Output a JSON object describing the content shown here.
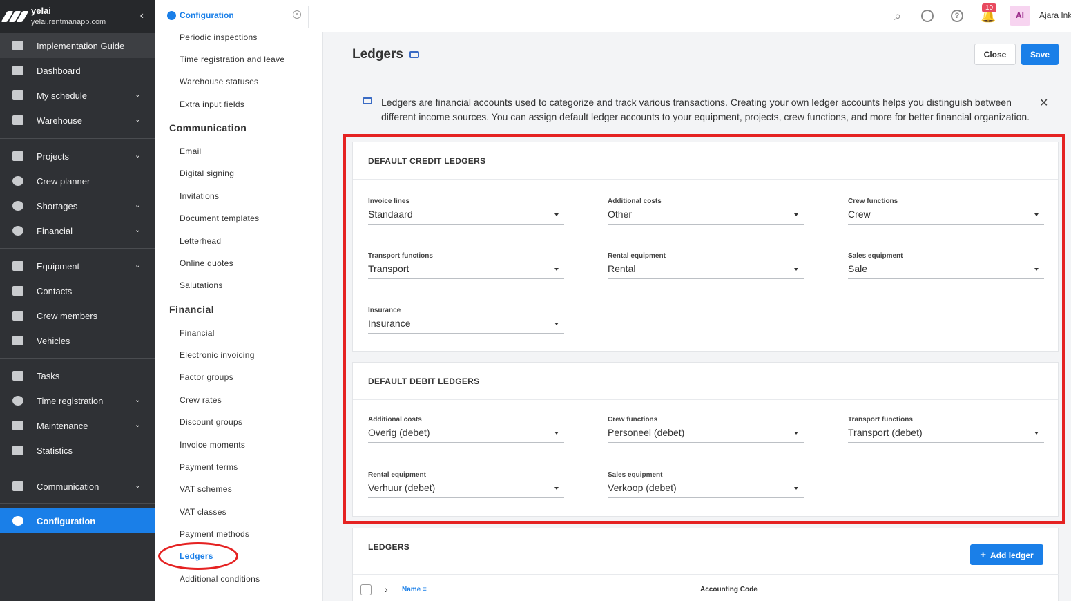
{
  "nav": {
    "tenant": "yelai",
    "url": "yelai.rentmanapp.com",
    "items": [
      {
        "label": "Implementation Guide",
        "icon": "checklist-icon"
      },
      {
        "label": "Dashboard",
        "icon": "dashboard-icon"
      },
      {
        "label": "My schedule",
        "icon": "calendar-icon"
      },
      {
        "label": "Warehouse",
        "icon": "warehouse-icon"
      },
      {
        "label": "Projects",
        "icon": "projects-icon"
      },
      {
        "label": "Crew planner",
        "icon": "crew-planner-icon"
      },
      {
        "label": "Shortages",
        "icon": "shortages-icon"
      },
      {
        "label": "Financial",
        "icon": "dollar-icon"
      },
      {
        "label": "Equipment",
        "icon": "equipment-icon"
      },
      {
        "label": "Contacts",
        "icon": "contacts-icon"
      },
      {
        "label": "Crew members",
        "icon": "people-icon"
      },
      {
        "label": "Vehicles",
        "icon": "truck-icon"
      },
      {
        "label": "Tasks",
        "icon": "tasks-icon"
      },
      {
        "label": "Time registration",
        "icon": "clock-icon"
      },
      {
        "label": "Maintenance",
        "icon": "wrench-icon"
      },
      {
        "label": "Statistics",
        "icon": "statistics-icon"
      },
      {
        "label": "Communication",
        "icon": "message-icon"
      },
      {
        "label": "Configuration",
        "icon": "gear-icon"
      }
    ]
  },
  "topbar": {
    "tab_label": "Configuration",
    "notification_count": "10",
    "avatar_initials": "AI",
    "user_name": "Ajara Ink"
  },
  "settings_list": {
    "items": [
      "Periodic inspections",
      "Time registration and leave",
      "Warehouse statuses",
      "Extra input fields",
      "Email",
      "Digital signing",
      "Invitations",
      "Document templates",
      "Letterhead",
      "Online quotes",
      "Salutations",
      "Financial",
      "Electronic invoicing",
      "Factor groups",
      "Crew rates",
      "Discount groups",
      "Invoice moments",
      "Payment terms",
      "VAT schemes",
      "VAT classes",
      "Payment methods",
      "Ledgers",
      "Additional conditions"
    ],
    "headings": [
      "Communication",
      "Financial"
    ]
  },
  "page": {
    "title": "Ledgers",
    "close_label": "Close",
    "save_label": "Save",
    "info": "Ledgers are financial accounts used to categorize and track various transactions. Creating your own ledger accounts helps you distinguish between different income sources. You can assign default ledger accounts to your equipment, projects, crew functions, and more for better financial organization."
  },
  "credit": {
    "title": "DEFAULT CREDIT LEDGERS",
    "fields": [
      {
        "label": "Invoice lines",
        "value": "Standaard"
      },
      {
        "label": "Additional costs",
        "value": "Other"
      },
      {
        "label": "Crew functions",
        "value": "Crew"
      },
      {
        "label": "Transport functions",
        "value": "Transport"
      },
      {
        "label": "Rental equipment",
        "value": "Rental"
      },
      {
        "label": "Sales equipment",
        "value": "Sale"
      },
      {
        "label": "Insurance",
        "value": "Insurance"
      }
    ]
  },
  "debit": {
    "title": "DEFAULT DEBIT LEDGERS",
    "fields": [
      {
        "label": "Additional costs",
        "value": "Overig (debet)"
      },
      {
        "label": "Crew functions",
        "value": "Personeel (debet)"
      },
      {
        "label": "Transport functions",
        "value": "Transport (debet)"
      },
      {
        "label": "Rental equipment",
        "value": "Verhuur (debet)"
      },
      {
        "label": "Sales equipment",
        "value": "Verkoop (debet)"
      }
    ]
  },
  "ledgers_table": {
    "title": "LEDGERS",
    "add_label": "Add ledger",
    "col_name": "Name",
    "col_code": "Accounting Code"
  },
  "colors": {
    "accent": "#1a7fe8",
    "highlight": "#e52222",
    "nav_bg": "#2f3135"
  }
}
